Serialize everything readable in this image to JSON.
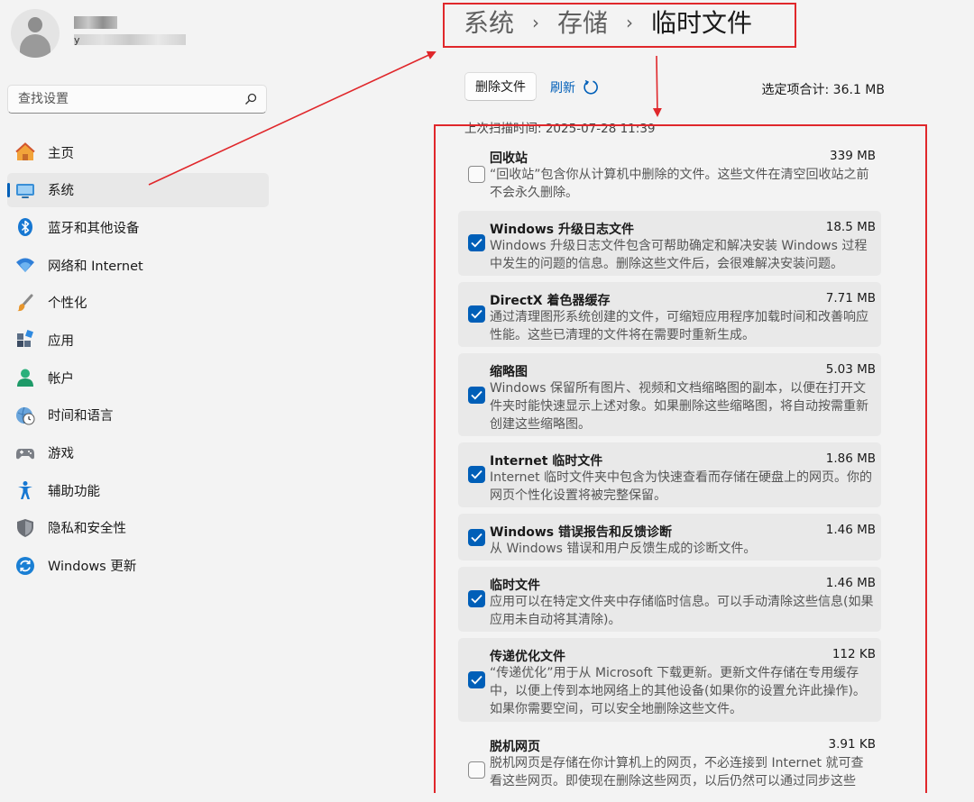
{
  "sidebar": {
    "user_email_visible": "y",
    "search_placeholder": "查找设置",
    "items": [
      {
        "label": "主页",
        "icon": "home-icon",
        "active": false
      },
      {
        "label": "系统",
        "icon": "monitor-icon",
        "active": true
      },
      {
        "label": "蓝牙和其他设备",
        "icon": "bluetooth-icon",
        "active": false
      },
      {
        "label": "网络和 Internet",
        "icon": "wifi-icon",
        "active": false
      },
      {
        "label": "个性化",
        "icon": "brush-icon",
        "active": false
      },
      {
        "label": "应用",
        "icon": "apps-icon",
        "active": false
      },
      {
        "label": "帐户",
        "icon": "account-icon",
        "active": false
      },
      {
        "label": "时间和语言",
        "icon": "globe-clock-icon",
        "active": false
      },
      {
        "label": "游戏",
        "icon": "gamepad-icon",
        "active": false
      },
      {
        "label": "辅助功能",
        "icon": "accessibility-icon",
        "active": false
      },
      {
        "label": "隐私和安全性",
        "icon": "shield-icon",
        "active": false
      },
      {
        "label": "Windows 更新",
        "icon": "sync-icon",
        "active": false
      }
    ]
  },
  "breadcrumb": {
    "items": [
      "系统",
      "存储",
      "临时文件"
    ],
    "separator": "›"
  },
  "toolbar": {
    "delete_label": "删除文件",
    "refresh_label": "刷新",
    "total_label": "选定项合计: 36.1 MB"
  },
  "scan_time": "上次扫描时间: 2025-07-28 11:39",
  "items": [
    {
      "name": "回收站",
      "size": "339 MB",
      "checked": false,
      "description": "“回收站”包含你从计算机中删除的文件。这些文件在清空回收站之前不会永久删除。"
    },
    {
      "name": "Windows 升级日志文件",
      "size": "18.5 MB",
      "checked": true,
      "description": "Windows 升级日志文件包含可帮助确定和解决安装 Windows 过程中发生的问题的信息。删除这些文件后，会很难解决安装问题。"
    },
    {
      "name": "DirectX 着色器缓存",
      "size": "7.71 MB",
      "checked": true,
      "description": "通过清理图形系统创建的文件，可缩短应用程序加载时间和改善响应性能。这些已清理的文件将在需要时重新生成。"
    },
    {
      "name": "缩略图",
      "size": "5.03 MB",
      "checked": true,
      "description": "Windows 保留所有图片、视频和文档缩略图的副本，以便在打开文件夹时能快速显示上述对象。如果删除这些缩略图，将自动按需重新创建这些缩略图。"
    },
    {
      "name": "Internet 临时文件",
      "size": "1.86 MB",
      "checked": true,
      "description": "Internet 临时文件夹中包含为快速查看而存储在硬盘上的网页。你的网页个性化设置将被完整保留。"
    },
    {
      "name": "Windows 错误报告和反馈诊断",
      "size": "1.46 MB",
      "checked": true,
      "description": "从 Windows 错误和用户反馈生成的诊断文件。"
    },
    {
      "name": "临时文件",
      "size": "1.46 MB",
      "checked": true,
      "description": "应用可以在特定文件夹中存储临时信息。可以手动清除这些信息(如果应用未自动将其清除)。"
    },
    {
      "name": "传递优化文件",
      "size": "112 KB",
      "checked": true,
      "description": "“传递优化”用于从 Microsoft 下载更新。更新文件存储在专用缓存中，以便上传到本地网络上的其他设备(如果你的设置允许此操作)。如果你需要空间，可以安全地删除这些文件。"
    },
    {
      "name": "脱机网页",
      "size": "3.91 KB",
      "checked": false,
      "description": "脱机网页是存储在你计算机上的网页，不必连接到 Internet 就可查看这些网页。即使现在删除这些网页，以后仍然可以通过同步这些"
    }
  ],
  "colors": {
    "accent": "#005fb8",
    "annotation": "#e0272b",
    "background": "#f3f3f3"
  }
}
